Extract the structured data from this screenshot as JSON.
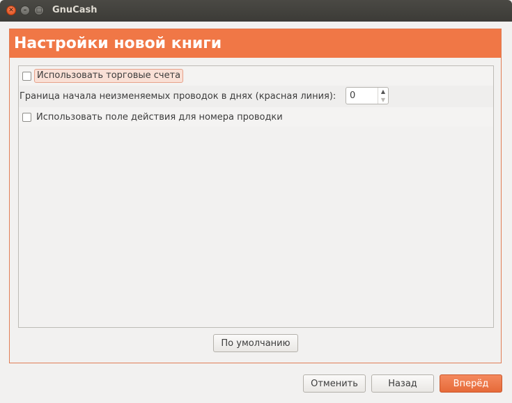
{
  "window": {
    "title": "GnuCash"
  },
  "page": {
    "heading": "Настройки новой книги"
  },
  "options": {
    "trading_accounts_label": "Использовать торговые счета",
    "trading_accounts_checked": false,
    "read_only_days_label": "Граница начала неизменяемых проводок в днях (красная линия):",
    "read_only_days_value": "0",
    "num_action_label": "Использовать поле действия для номера проводки",
    "num_action_checked": false
  },
  "buttons": {
    "defaults": "По умолчанию",
    "cancel": "Отменить",
    "back": "Назад",
    "forward": "Вперёд"
  },
  "colors": {
    "accent": "#f07746",
    "titlebar": "#3c3b37"
  }
}
